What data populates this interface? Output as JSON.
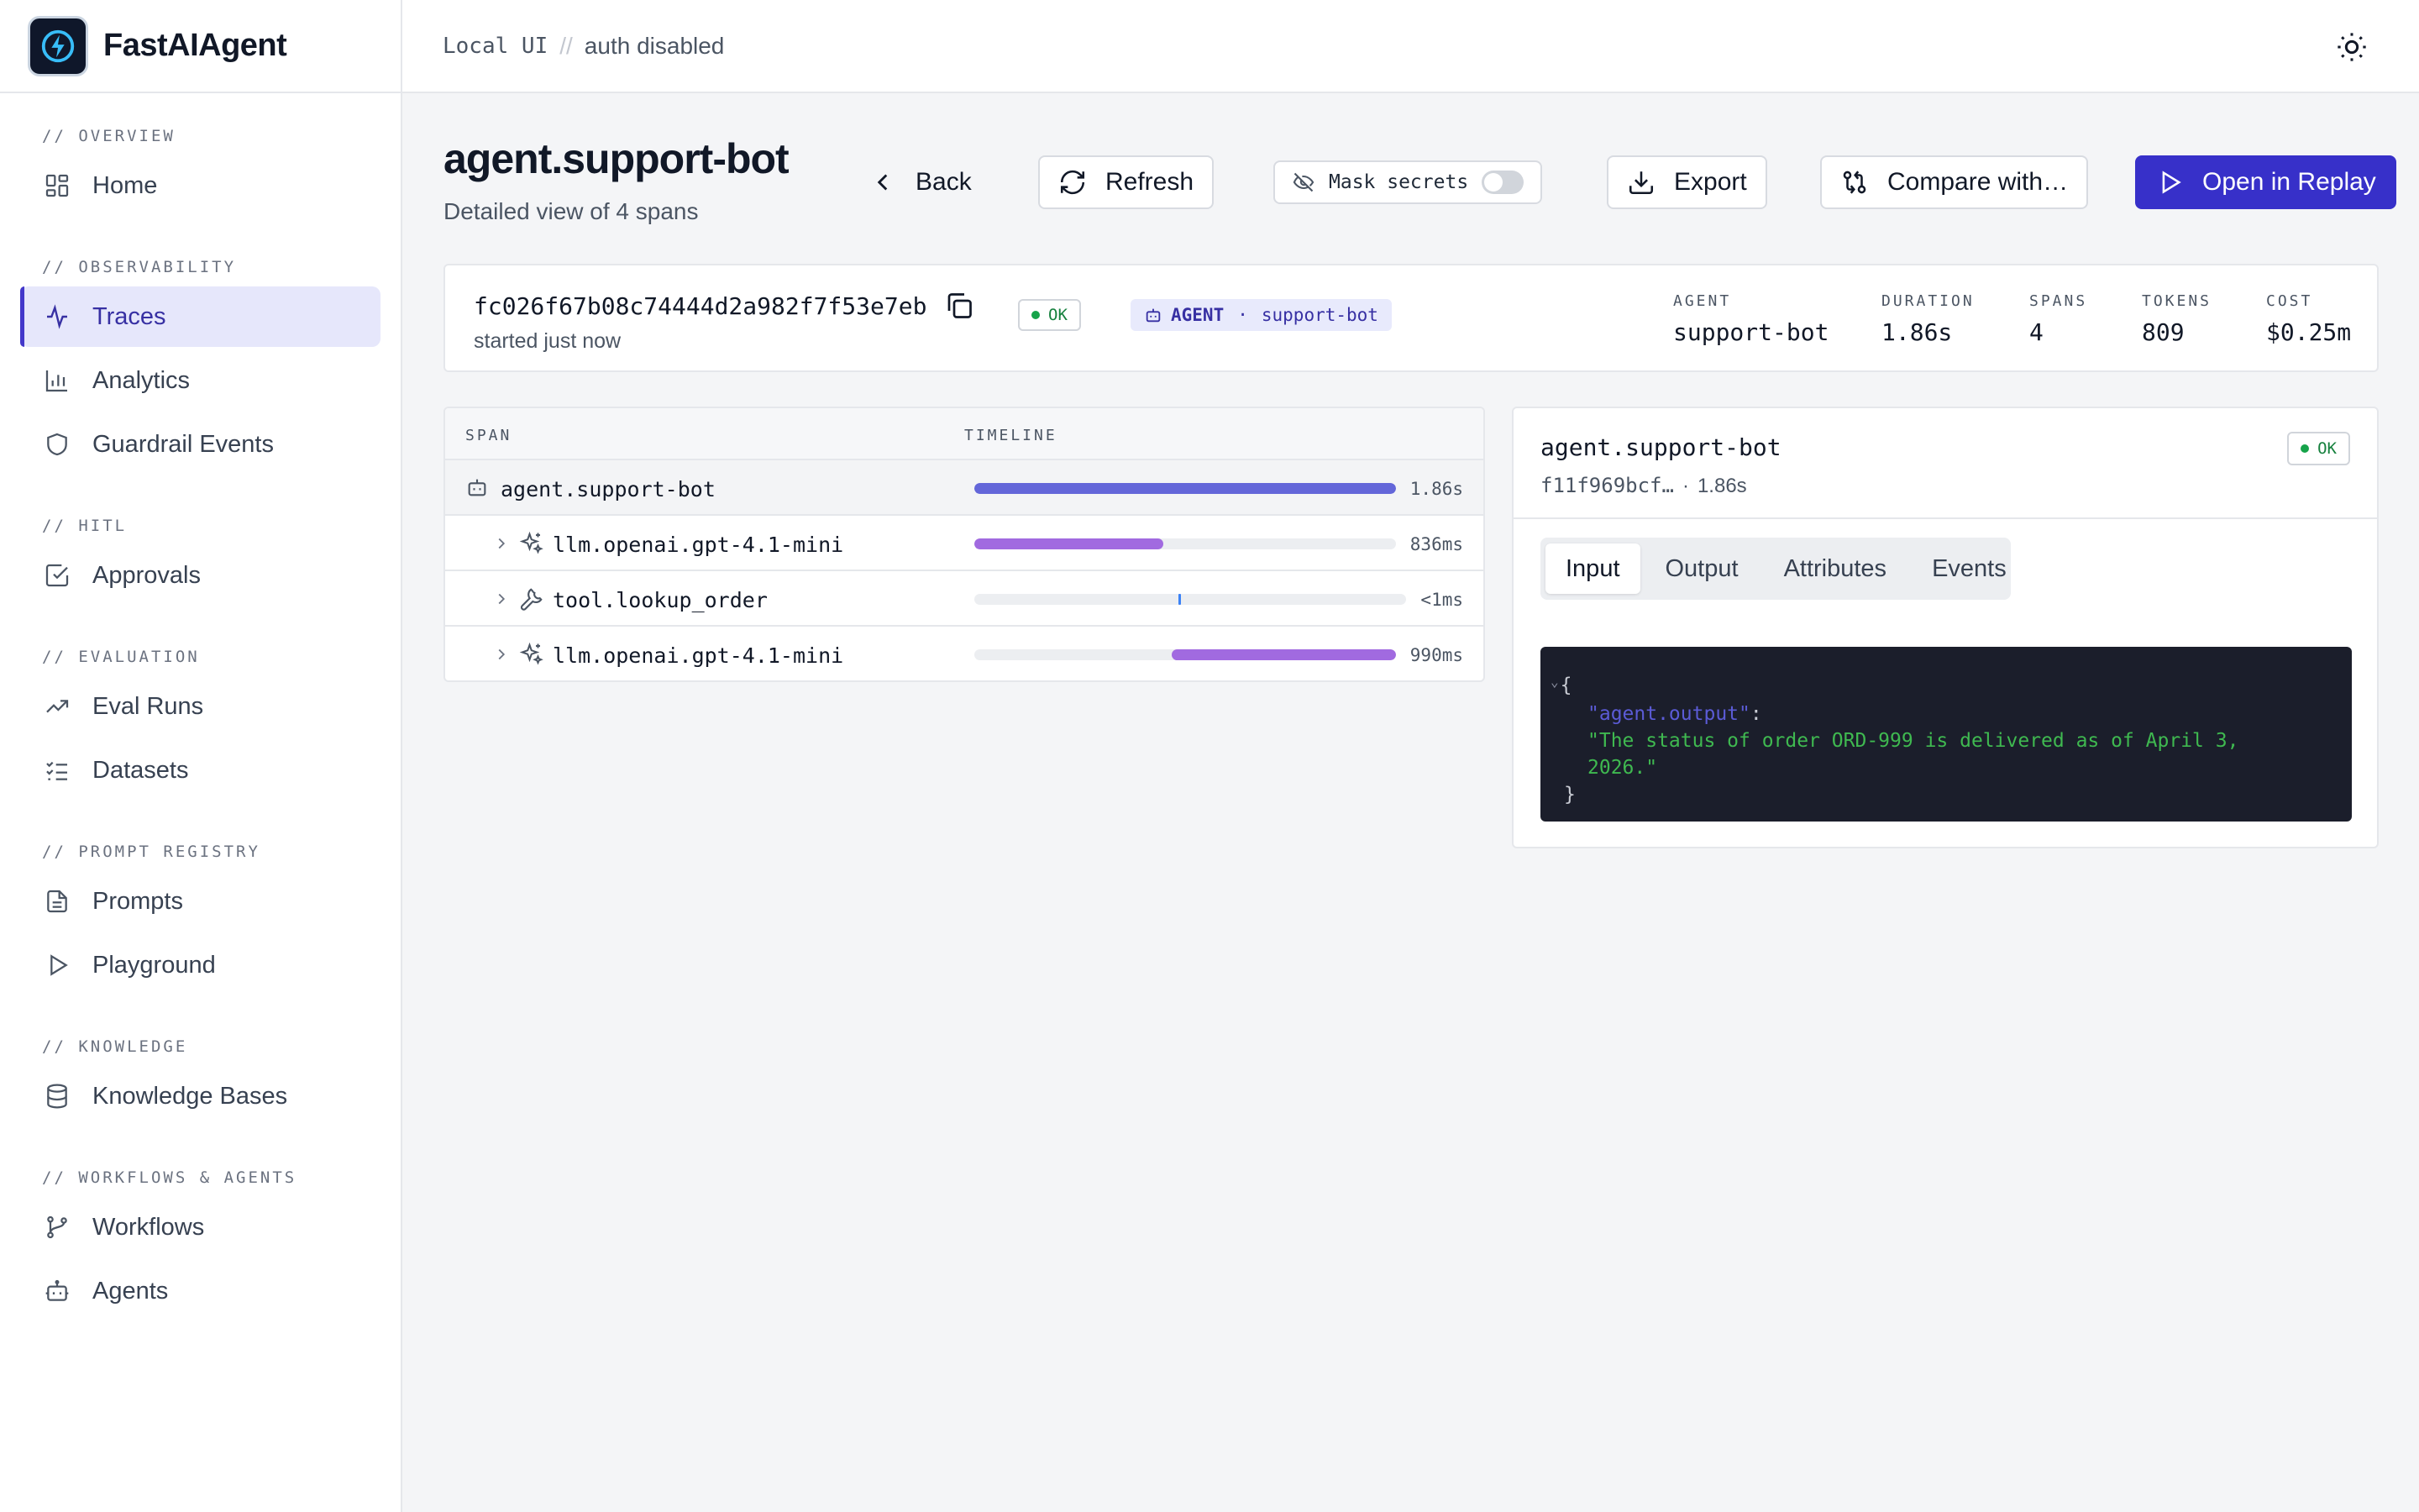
{
  "app": {
    "name": "FastAIAgent"
  },
  "topbar": {
    "mode": "Local UI",
    "separator": "//",
    "auth": "auth disabled"
  },
  "sidebar": {
    "sections": [
      {
        "title": "// OVERVIEW",
        "items": [
          {
            "label": "Home",
            "icon": "grid-icon",
            "active": false
          }
        ]
      },
      {
        "title": "// OBSERVABILITY",
        "items": [
          {
            "label": "Traces",
            "icon": "activity-icon",
            "active": true
          },
          {
            "label": "Analytics",
            "icon": "bar-chart-icon",
            "active": false
          },
          {
            "label": "Guardrail Events",
            "icon": "shield-icon",
            "active": false
          }
        ]
      },
      {
        "title": "// HITL",
        "items": [
          {
            "label": "Approvals",
            "icon": "check-square-icon",
            "active": false
          }
        ]
      },
      {
        "title": "// EVALUATION",
        "items": [
          {
            "label": "Eval Runs",
            "icon": "trending-up-icon",
            "active": false
          },
          {
            "label": "Datasets",
            "icon": "list-checks-icon",
            "active": false
          }
        ]
      },
      {
        "title": "// PROMPT REGISTRY",
        "items": [
          {
            "label": "Prompts",
            "icon": "file-text-icon",
            "active": false
          },
          {
            "label": "Playground",
            "icon": "play-icon",
            "active": false
          }
        ]
      },
      {
        "title": "// KNOWLEDGE",
        "items": [
          {
            "label": "Knowledge Bases",
            "icon": "database-icon",
            "active": false
          }
        ]
      },
      {
        "title": "// WORKFLOWS & AGENTS",
        "items": [
          {
            "label": "Workflows",
            "icon": "git-branch-icon",
            "active": false
          },
          {
            "label": "Agents",
            "icon": "bot-icon",
            "active": false
          }
        ]
      }
    ]
  },
  "header": {
    "title": "agent.support-bot",
    "subtitle": "Detailed view of 4 spans",
    "back_label": "Back",
    "refresh_label": "Refresh",
    "mask_label": "Mask secrets",
    "mask_enabled": false,
    "export_label": "Export",
    "compare_label": "Compare with…",
    "replay_label": "Open in Replay"
  },
  "summary": {
    "trace_id": "fc026f67b08c74444d2a982f7f53e7eb",
    "started": "started just now",
    "status": "OK",
    "kind": "AGENT",
    "kind_sep": "·",
    "kind_name": "support-bot",
    "stats": [
      {
        "label": "AGENT",
        "value": "support-bot"
      },
      {
        "label": "DURATION",
        "value": "1.86s"
      },
      {
        "label": "SPANS",
        "value": "4"
      },
      {
        "label": "TOKENS",
        "value": "809"
      },
      {
        "label": "COST",
        "value": "$0.25m"
      }
    ]
  },
  "spans": {
    "headers": {
      "span": "SPAN",
      "timeline": "TIMELINE"
    },
    "rows": [
      {
        "name": "agent.support-bot",
        "duration": "1.86s",
        "kind": "agent",
        "start_frac": 0.0,
        "width_frac": 1.0,
        "color": "#6366d9"
      },
      {
        "name": "llm.openai.gpt-4.1-mini",
        "duration": "836ms",
        "kind": "llm",
        "start_frac": 0.0,
        "width_frac": 0.449,
        "color": "#a16ae0"
      },
      {
        "name": "tool.lookup_order",
        "duration": "<1ms",
        "kind": "tool",
        "start_frac": 0.473,
        "width_frac": 0.004,
        "color": "#3b82f6"
      },
      {
        "name": "llm.openai.gpt-4.1-mini",
        "duration": "990ms",
        "kind": "llm",
        "start_frac": 0.468,
        "width_frac": 0.532,
        "color": "#a16ae0"
      }
    ]
  },
  "detail": {
    "title": "agent.support-bot",
    "span_id": "f11f969bcf…",
    "meta_sep": "·",
    "duration": "1.86s",
    "status": "OK",
    "tabs": [
      "Input",
      "Output",
      "Attributes",
      "Events"
    ],
    "active_tab": "Input",
    "code": {
      "open": "{",
      "key": "\"agent.output\"",
      "colon": ":",
      "value_line1": "\"The status of order ORD-999 is delivered as of April 3,",
      "value_line2": "2026.\"",
      "close": "}"
    }
  },
  "colors": {
    "accent": "#3730c9",
    "ok": "#16a34a",
    "agent_bar": "#6366d9",
    "llm_bar": "#a16ae0",
    "tool_bar": "#3b82f6"
  }
}
